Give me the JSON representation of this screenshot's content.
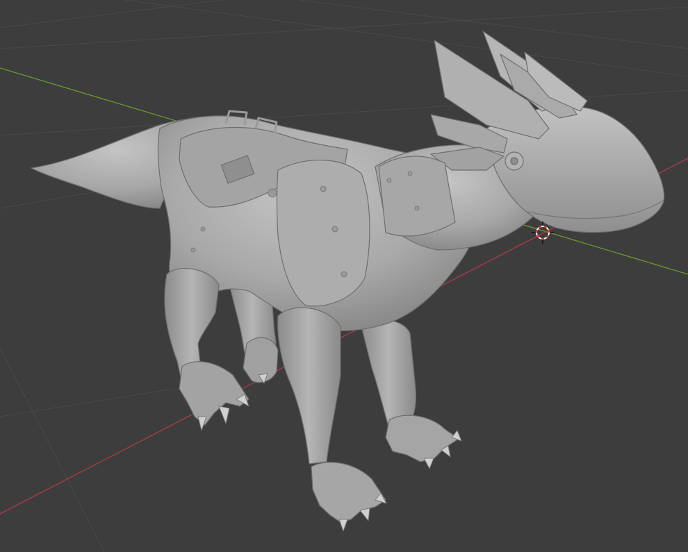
{
  "viewport": {
    "background": "#3d3d3d",
    "grid_color": "#4a4a4a",
    "x_axis_color": "#b03a4a",
    "y_axis_color": "#6f9a2c",
    "cursor_color_a": "#ff3b3b",
    "cursor_color_b": "#ffffff"
  },
  "model": {
    "type": "armored-raptor-sculpt",
    "base_color": "#a9a9a9",
    "shadow_color": "#7d7d7d",
    "highlight_color": "#c8c8c8",
    "shading": "solid"
  },
  "icons": {
    "cursor": "3d-cursor-icon"
  }
}
